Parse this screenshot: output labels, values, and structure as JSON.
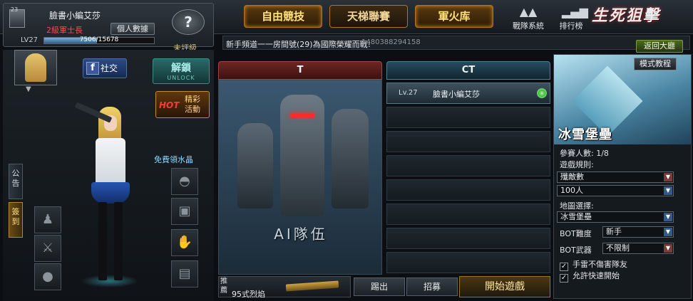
{
  "player": {
    "rank_badge": "23",
    "name": "臉書小編艾莎",
    "title": "2級軍士長",
    "personal_data_button": "個人數據",
    "level": "LV27",
    "xp_text": "7506/15678",
    "xp_fraction": 0.479,
    "rating_label": "未評級"
  },
  "modes": {
    "free_competition": "自由競技",
    "ladder": "天梯聯賽",
    "armory": "軍火库"
  },
  "nav": {
    "clan": "戰隊系統",
    "ranking": "排行榜"
  },
  "logo": "生死狙擊",
  "notice": {
    "text": "新手頻道一一房間號(29)為國際榮耀而戰!",
    "code": "1480388294158"
  },
  "back_lobby": "返回大廳",
  "left": {
    "social_button": "社交",
    "unlock_main": "解鎖",
    "unlock_sub": "UNLOCK",
    "hot_badge": "HOT",
    "hot_label": "精彩活動",
    "crystal_link": "免費領水晶",
    "tab_announcement": "公告",
    "tab_checkin": "簽到"
  },
  "teams": {
    "t_label": "T",
    "ct_label": "CT",
    "ai_team": "AI隊伍",
    "ct_players": [
      {
        "level": "Lv.27",
        "name": "臉書小編艾莎",
        "ready": true
      }
    ]
  },
  "bottom": {
    "recommend_tag": "推薦",
    "recommend_weapon": "95式烈焰",
    "kick": "踢出",
    "recruit": "招募",
    "start": "開始遊戲"
  },
  "room": {
    "tutorial_button": "模式教程",
    "map_name": "冰雪堡壘",
    "players_label": "參賽人數:",
    "players_value": "1/8",
    "rule_label": "遊戲規則:",
    "rule_value": "殲敵數",
    "kill_target": "100人",
    "map_label": "地圖選擇:",
    "map_value": "冰雪堡壘",
    "bot_difficulty_label": "BOT難度",
    "bot_difficulty_value": "新手",
    "bot_weapon_label": "BOT武器",
    "bot_weapon_value": "不限制",
    "grenade_no_friendly": "手雷不傷害隊友",
    "allow_quick_join": "允許快速開始",
    "grenade_checked": true,
    "quick_join_checked": true
  }
}
